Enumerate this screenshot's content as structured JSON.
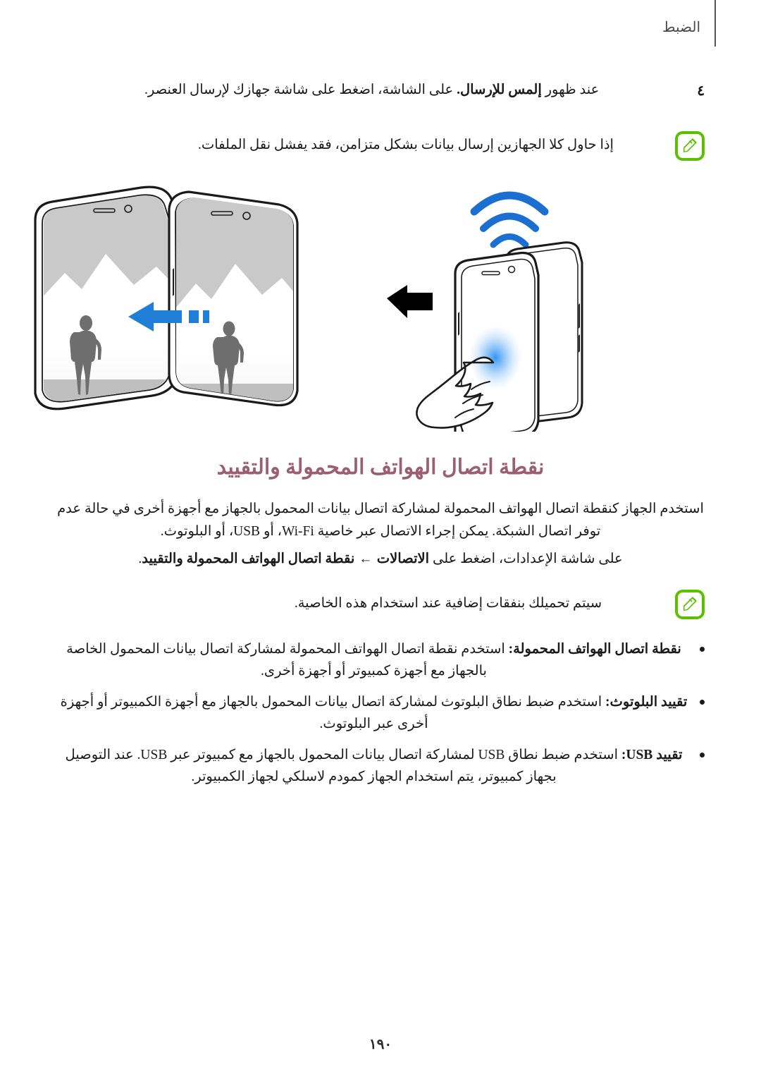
{
  "header": {
    "title": "الضبط"
  },
  "step": {
    "number": "٤",
    "bold_part": "إلمس للإرسال.",
    "text_before": "عند ظهور ",
    "text_after": " على الشاشة، اضغط على شاشة جهازك لإرسال العنصر."
  },
  "note_1": {
    "icon": "note-pen-icon",
    "text": "إذا حاول كلا الجهازين إرسال بيانات بشكل متزامن، فقد يفشل نقل الملفات."
  },
  "illustration": {
    "name": "nfc-android-beam-illustration",
    "left_phone_label": "phone-receiving-photo",
    "right_phone_label": "phone-sending-photo",
    "tap_phone_label": "phone-tap-to-send",
    "wave_label": "nfc-waves",
    "arrow_label": "transfer-arrow"
  },
  "section": {
    "heading": "نقطة اتصال الهواتف المحمولة والتقييد",
    "heading_color": "#9a5f70",
    "intro_line_1": "استخدم الجهاز كنقطة اتصال الهواتف المحمولة لمشاركة اتصال بيانات المحمول بالجهاز مع أجهزة أخرى في حالة عدم",
    "intro_line_2": "توفر اتصال الشبكة. يمكن إجراء الاتصال عبر خاصية Wi-Fi، أو USB، أو البلوتوث.",
    "path_prefix": "على شاشة الإعدادات، اضغط على ",
    "path_item_1": "الاتصالات",
    "path_arrow": "←",
    "path_item_2": "نقطة اتصال الهواتف المحمولة والتقييد",
    "path_suffix": "."
  },
  "note_2": {
    "icon": "note-pen-icon",
    "text": "سيتم تحميلك بنفقات إضافية عند استخدام هذه الخاصية."
  },
  "bullets": [
    {
      "term": "نقطة اتصال الهواتف المحمولة:",
      "description": " استخدم نقطة اتصال الهواتف المحمولة لمشاركة اتصال بيانات المحمول الخاصة بالجهاز مع أجهزة كمبيوتر أو أجهزة أخرى."
    },
    {
      "term": "تقييد البلوتوث:",
      "description": " استخدم ضبط نطاق البلوتوث لمشاركة اتصال بيانات المحمول بالجهاز مع أجهزة الكمبيوتر أو أجهزة أخرى عبر البلوتوث."
    },
    {
      "term": "تقييد USB:",
      "description": " استخدم ضبط نطاق USB لمشاركة اتصال بيانات المحمول بالجهاز مع كمبيوتر عبر USB. عند التوصيل بجهاز كمبيوتر، يتم استخدام الجهاز كمودم لاسلكي لجهاز الكمبيوتر."
    }
  ],
  "page_number": "١٩٠",
  "colors": {
    "accent_heading": "#9a5f70",
    "note_green": "#5bc000",
    "nfc_blue": "#1b6fd0",
    "tap_glow": "#3e9bf0"
  }
}
